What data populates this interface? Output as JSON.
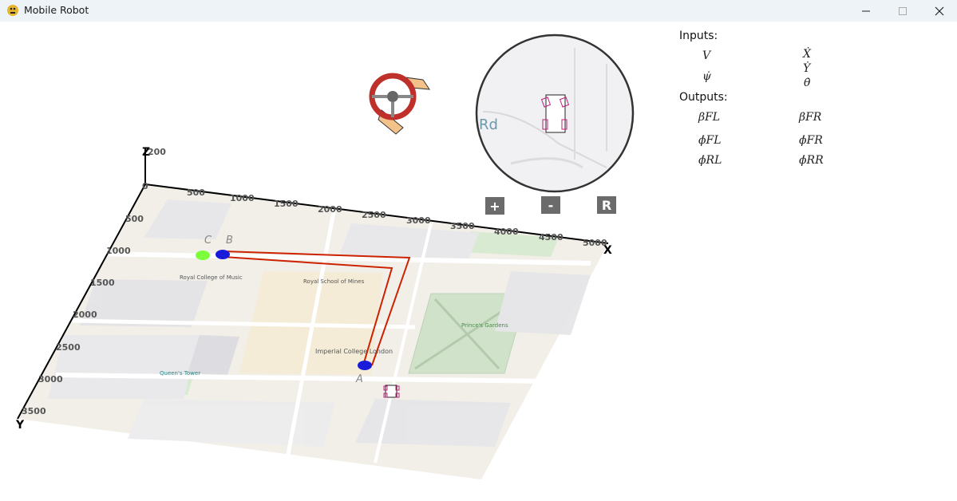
{
  "window": {
    "title": "Mobile Robot",
    "controls": [
      "minimize",
      "maximize",
      "close"
    ]
  },
  "zoom_controls": {
    "zoom_in": "+",
    "zoom_out": "-",
    "reset": "R"
  },
  "axes": {
    "x_label": "X",
    "y_label": "Y",
    "z_label": "Z",
    "x_ticks": [
      "500",
      "1000",
      "1500",
      "2000",
      "2500",
      "3000",
      "3500",
      "4000",
      "4500",
      "5000"
    ],
    "y_ticks": [
      "0",
      "500",
      "1000",
      "1500",
      "2000",
      "2500",
      "3000",
      "3500"
    ],
    "z_ticks": [
      "200"
    ]
  },
  "waypoints": {
    "a": "A",
    "b": "B",
    "c": "C"
  },
  "map": {
    "labels": [
      "Imperial College London",
      "Prince's Gardens",
      "Royal College of Music",
      "Royal School of Mines",
      "Queen's Tower",
      "Rd"
    ]
  },
  "colors": {
    "path": "#cc2200",
    "waypoint_blue": "#1a1adb",
    "waypoint_green": "#7cff3a",
    "zoom_button": "#6b6b6b"
  },
  "panel": {
    "inputs_label": "Inputs:",
    "outputs_label": "Outputs:",
    "inputs": [
      {
        "left": "V",
        "right": "Ẋ"
      },
      {
        "left": "ψ̇",
        "right": "Ẏ"
      },
      {
        "left": "",
        "right": "θ̇"
      }
    ],
    "outputs": [
      {
        "left": "βFL",
        "right": "βFR"
      },
      {
        "left": "ϕ̇FL",
        "right": "ϕ̇FR"
      },
      {
        "left": "ϕ̇RL",
        "right": "ϕ̇RR"
      }
    ]
  }
}
